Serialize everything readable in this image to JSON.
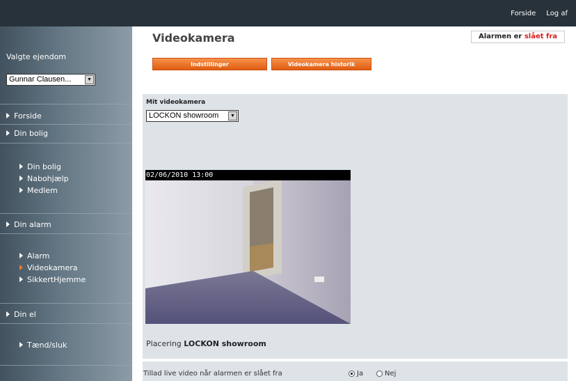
{
  "header": {
    "links": [
      "Forside",
      "Log af"
    ]
  },
  "sidebar": {
    "property_label": "Valgte ejendom",
    "property_select": "Gunnar Clausen...",
    "sections": [
      {
        "label": "Forside"
      },
      {
        "label": "Din bolig"
      },
      {
        "label": "Din bolig"
      },
      {
        "label": "Nabohjælp"
      },
      {
        "label": "Medlem"
      },
      {
        "label": "Din alarm"
      },
      {
        "label": "Alarm"
      },
      {
        "label": "Videokamera"
      },
      {
        "label": "SikkertHjemme"
      },
      {
        "label": "Din el"
      },
      {
        "label": "Tænd/sluk"
      }
    ]
  },
  "main": {
    "title": "Videokamera",
    "alarm_status_prefix": "Alarmen er",
    "alarm_status_value": "slået fra",
    "buttons": {
      "settings": "Indstillinger",
      "history": "Videokamera historik"
    },
    "camera_label": "Mit videokamera",
    "camera_select": "LOCKON showroom",
    "timestamp": "02/06/2010 13:00",
    "placement_prefix": "Placering",
    "placement_value": "LOCKON showroom",
    "live_video_label": "Tillad live video når alarmen er slået fra",
    "radio_yes": "Ja",
    "radio_no": "Nej",
    "live_video_selected": "Ja"
  },
  "colors": {
    "accent": "#e8671d",
    "alarm_off": "#d81e1e"
  }
}
